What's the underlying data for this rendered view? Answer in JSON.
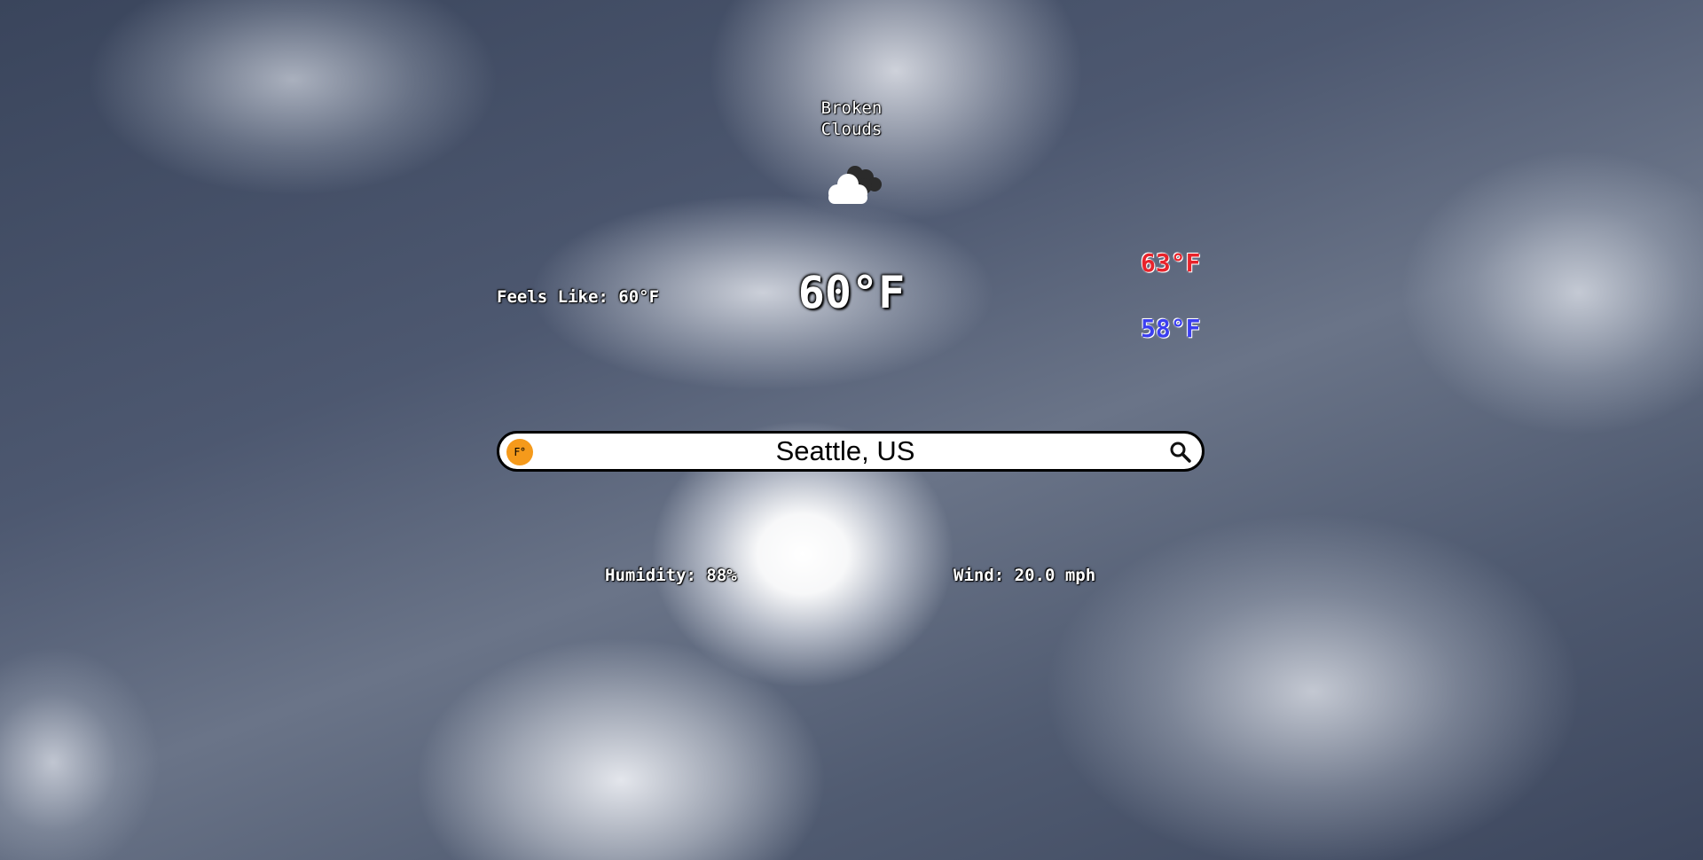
{
  "weather": {
    "condition": "Broken\nClouds",
    "condition_icon": "broken-clouds-icon",
    "temperature": "60°F",
    "feels_like": "Feels Like: 60°F",
    "high": "63°F",
    "low": "58°F",
    "humidity": "Humidity: 88%",
    "wind": "Wind: 20.0 mph"
  },
  "search": {
    "value": "Seattle, US",
    "unit_toggle_label": "F°",
    "search_icon": "search-icon"
  },
  "colors": {
    "high_temp": "#e8232b",
    "low_temp": "#3b3ef0",
    "unit_toggle": "#f59a1b"
  }
}
